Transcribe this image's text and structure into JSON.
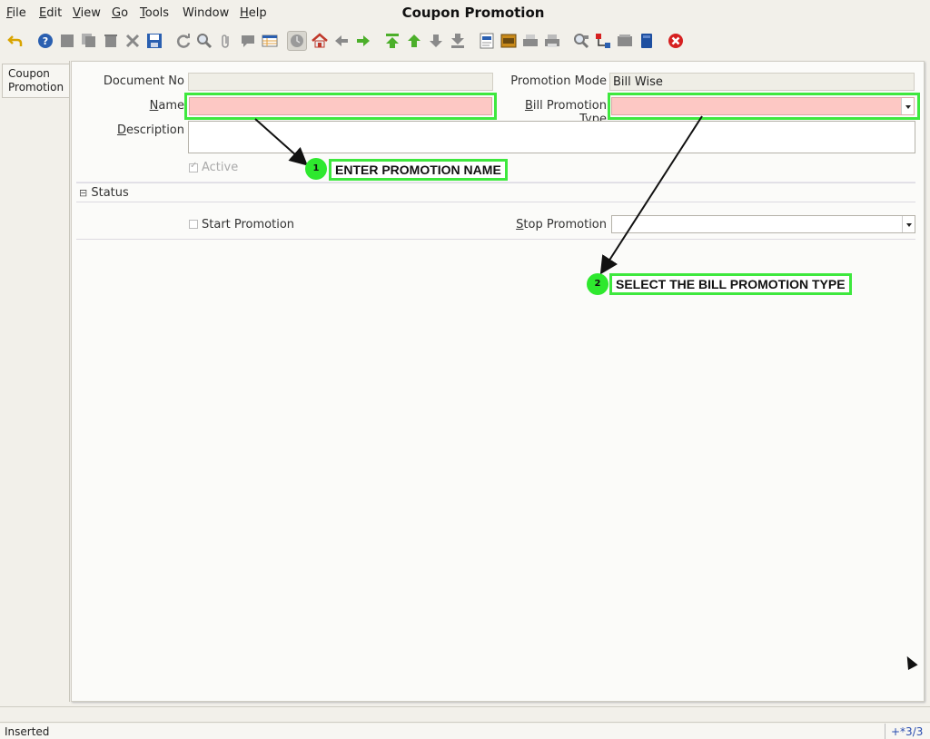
{
  "window": {
    "title": "Coupon Promotion"
  },
  "menu": [
    {
      "label": "File",
      "key": "F",
      "rest": "ile"
    },
    {
      "label": "Edit",
      "key": "E",
      "rest": "dit"
    },
    {
      "label": "View",
      "key": "V",
      "rest": "iew"
    },
    {
      "label": "Go",
      "key": "G",
      "rest": "o"
    },
    {
      "label": "Tools",
      "key": "T",
      "rest": "ools"
    },
    {
      "label": "Window",
      "key": "",
      "rest": "Window"
    },
    {
      "label": "Help",
      "key": "H",
      "rest": "elp"
    }
  ],
  "toolbar_icons": [
    "undo-icon",
    "help-icon",
    "new-record-icon",
    "copy-record-icon",
    "delete-icon",
    "delete-selection-icon",
    "save-icon",
    "refresh-icon",
    "find-icon",
    "attachment-icon",
    "chat-icon",
    "grid-toggle-icon",
    "history-icon",
    "home-icon",
    "previous-record-icon",
    "next-record-icon",
    "first-record-icon",
    "parent-record-icon",
    "child-record-icon",
    "last-record-icon",
    "report-icon",
    "archive-icon",
    "print-preview-icon",
    "print-icon",
    "zoom-across-icon",
    "workflow-icon",
    "request-icon",
    "product-info-icon",
    "close-window-icon"
  ],
  "side_tab": {
    "line1": "Coupon",
    "line2": "Promotion"
  },
  "form": {
    "document_no_label": "Document No",
    "document_no_value": "",
    "promotion_mode_label": "Promotion Mode",
    "promotion_mode_value": "Bill Wise",
    "name_label_key": "N",
    "name_label_rest": "ame",
    "name_value": "",
    "bill_promotion_type_key": "B",
    "bill_promotion_type_rest": "ill Promotion Type",
    "bill_promotion_type_value": "",
    "description_key": "D",
    "description_rest": "escription",
    "description_value": "",
    "active_label": "Active",
    "active_checked": true
  },
  "status_section": {
    "toggle": "⊟",
    "title": "Status",
    "start_promotion_label": "Start Promotion",
    "start_promotion_checked": false,
    "stop_promotion_key": "S",
    "stop_promotion_rest": "top Promotion",
    "stop_promotion_value": ""
  },
  "annotations": [
    {
      "number": "1",
      "text": "ENTER PROMOTION NAME"
    },
    {
      "number": "2",
      "text": "SELECT THE BILL PROMOTION TYPE"
    }
  ],
  "status_bar": {
    "message": "Inserted",
    "record_info": "+*3/3"
  },
  "colors": {
    "mandatory": "#fdc8c4",
    "highlight": "#3ee83e",
    "badge": "#2ee82e"
  }
}
